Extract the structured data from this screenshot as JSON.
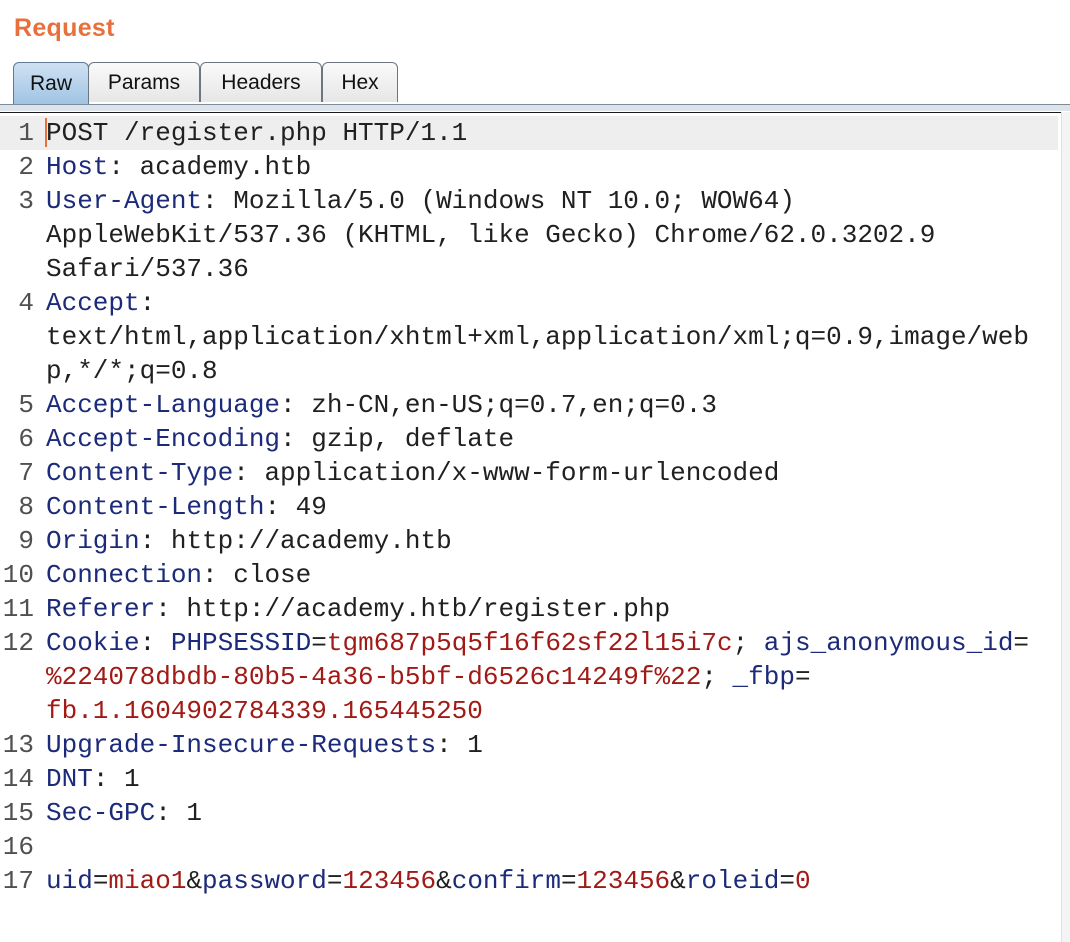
{
  "panel": {
    "title": "Request"
  },
  "tabs": [
    {
      "label": "Raw",
      "active": true
    },
    {
      "label": "Params",
      "active": false
    },
    {
      "label": "Headers",
      "active": false
    },
    {
      "label": "Hex",
      "active": false
    }
  ],
  "request": {
    "lines": [
      {
        "num": "1",
        "text": "POST /register.php HTTP/1.1"
      },
      {
        "num": "2",
        "key": "Host",
        "value": " academy.htb"
      },
      {
        "num": "3",
        "key": "User-Agent",
        "value": " Mozilla/5.0 (Windows NT 10.0; WOW64)",
        "cont": [
          "AppleWebKit/537.36 (KHTML, like Gecko) Chrome/62.0.3202.9",
          "Safari/537.36"
        ]
      },
      {
        "num": "4",
        "key": "Accept",
        "value": "",
        "cont": [
          "text/html,application/xhtml+xml,application/xml;q=0.9,image/web",
          "p,*/*;q=0.8"
        ]
      },
      {
        "num": "5",
        "key": "Accept-Language",
        "value": " zh-CN,en-US;q=0.7,en;q=0.3"
      },
      {
        "num": "6",
        "key": "Accept-Encoding",
        "value": " gzip, deflate"
      },
      {
        "num": "7",
        "key": "Content-Type",
        "value": " application/x-www-form-urlencoded"
      },
      {
        "num": "8",
        "key": "Content-Length",
        "value": " 49"
      },
      {
        "num": "9",
        "key": "Origin",
        "value": " http://academy.htb"
      },
      {
        "num": "10",
        "key": "Connection",
        "value": " close"
      },
      {
        "num": "11",
        "key": "Referer",
        "value": " http://academy.htb/register.php"
      },
      {
        "num": "12",
        "key": "Cookie",
        "cookies": [
          {
            "name": "PHPSESSID",
            "value": "tgm687p5q5f16f62sf22l15i7c"
          },
          {
            "name": "ajs_anonymous_id",
            "value": "%224078dbdb-80b5-4a36-b5bf-d6526c14249f%22"
          },
          {
            "name": "_fbp",
            "value": "fb.1.1604902784339.165445250"
          }
        ]
      },
      {
        "num": "13",
        "key": "Upgrade-Insecure-Requests",
        "value": " 1"
      },
      {
        "num": "14",
        "key": "DNT",
        "value": " 1"
      },
      {
        "num": "15",
        "key": "Sec-GPC",
        "value": " 1"
      },
      {
        "num": "16",
        "text": ""
      },
      {
        "num": "17",
        "params": [
          {
            "name": "uid",
            "value": "miao1"
          },
          {
            "name": "password",
            "value": "123456"
          },
          {
            "name": "confirm",
            "value": "123456"
          },
          {
            "name": "roleid",
            "value": "0"
          }
        ]
      }
    ]
  },
  "colors": {
    "title": "#e8703c",
    "header_key": "#1c2a7a",
    "param_value": "#a11a16",
    "active_tab": "#9fc3e4"
  }
}
